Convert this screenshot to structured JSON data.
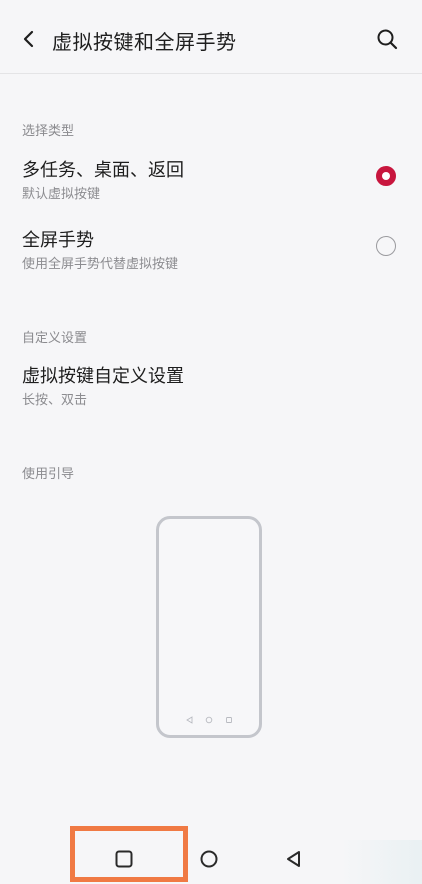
{
  "header": {
    "title": "虚拟按键和全屏手势",
    "back_icon": "chevron-left-icon",
    "search_icon": "search-icon"
  },
  "select_type": {
    "header": "选择类型",
    "options": [
      {
        "title": "多任务、桌面、返回",
        "subtitle": "默认虚拟按键",
        "selected": true
      },
      {
        "title": "全屏手势",
        "subtitle": "使用全屏手势代替虚拟按键",
        "selected": false
      }
    ]
  },
  "custom": {
    "header": "自定义设置",
    "item": {
      "title": "虚拟按键自定义设置",
      "subtitle": "长按、双击"
    }
  },
  "guide": {
    "header": "使用引导"
  },
  "nav": {
    "recents_icon": "square-icon",
    "home_icon": "circle-icon",
    "back_icon": "triangle-back-icon"
  },
  "colors": {
    "accent": "#c8163e",
    "highlight": "#f07a44",
    "background": "#f6f6f8"
  }
}
